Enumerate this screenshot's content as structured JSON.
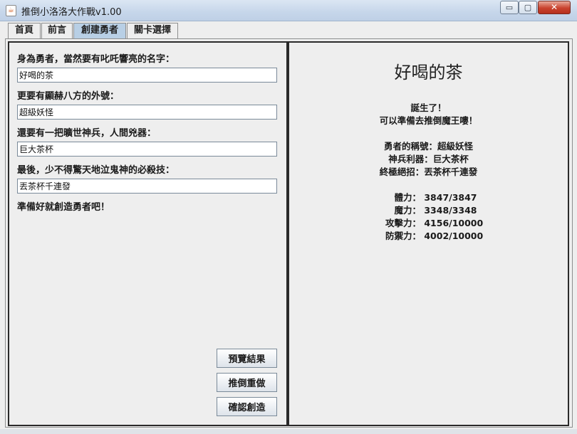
{
  "window": {
    "title": "推倒小洛洛大作戰v1.00",
    "icon": "java-cup-icon",
    "min_label": "▭",
    "max_label": "▢",
    "close_label": "✕"
  },
  "tabs": [
    {
      "label": "首頁"
    },
    {
      "label": "前言"
    },
    {
      "label": "創建勇者",
      "active": true
    },
    {
      "label": "關卡選擇"
    }
  ],
  "form": {
    "name_label": "身為勇者，當然要有叱吒響亮的名字：",
    "name_value": "好喝的茶",
    "title_label": "更要有顯赫八方的外號：",
    "title_value": "超級妖怪",
    "weapon_label": "還要有一把曠世神兵，人間兇器：",
    "weapon_value": "巨大茶杯",
    "skill_label": "最後，少不得驚天地泣鬼神的必殺技：",
    "skill_value": "丟茶杯千連發",
    "ready_text": "準備好就創造勇者吧！"
  },
  "buttons": {
    "preview": "預覽結果",
    "reset": "推倒重做",
    "confirm": "確認創造"
  },
  "preview": {
    "hero_name": "好喝的茶",
    "born": "誕生了！",
    "ready": "可以準備去推倒魔王嘍！",
    "title_line": "勇者的稱號：超級妖怪",
    "weapon_line": "神兵利器：巨大茶杯",
    "skill_line": "終極絕招：丟茶杯千連發",
    "stats": [
      {
        "label": "體力：",
        "value": "3847/3847"
      },
      {
        "label": "魔力：",
        "value": "3348/3348"
      },
      {
        "label": "攻擊力：",
        "value": "4156/10000"
      },
      {
        "label": "防禦力：",
        "value": "4002/10000"
      }
    ]
  },
  "colors": {
    "active_tab": "#b8cfe5",
    "close_button": "#c9432e",
    "panel_border": "#2a2a2a"
  }
}
